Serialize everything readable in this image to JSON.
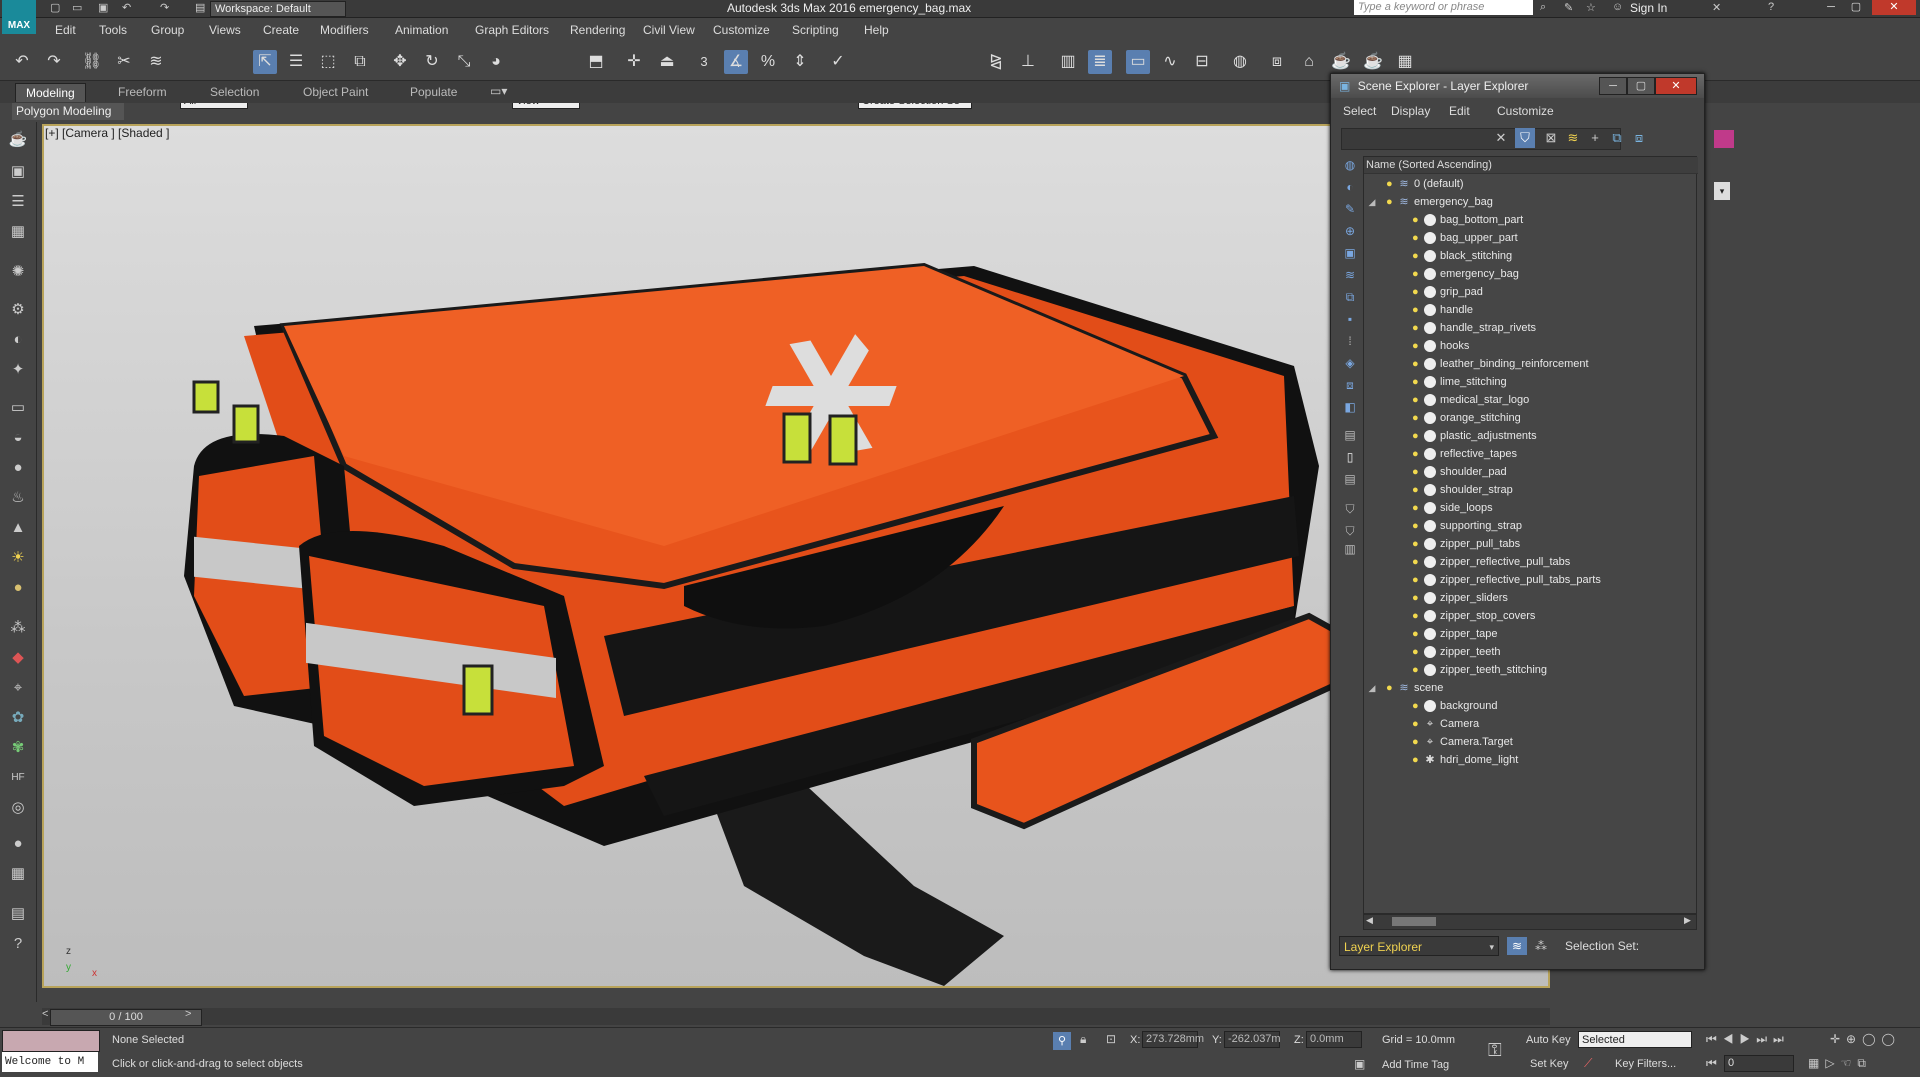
{
  "titlebar": {
    "app_logo_text": "MAX",
    "workspace": "Workspace: Default",
    "title": "Autodesk 3ds Max 2016      emergency_bag.max",
    "search_placeholder": "Type a keyword or phrase",
    "sign_in": "Sign In"
  },
  "menu": [
    "Edit",
    "Tools",
    "Group",
    "Views",
    "Create",
    "Modifiers",
    "Animation",
    "Graph Editors",
    "Rendering",
    "Civil View",
    "Customize",
    "Scripting",
    "Help"
  ],
  "toolbar": {
    "filter_select": "All",
    "reference_select": "View",
    "snap_label": "3",
    "selection_set_placeholder": "Create Selection Se"
  },
  "ribbon": {
    "tabs": [
      "Modeling",
      "Freeform",
      "Selection",
      "Object Paint",
      "Populate"
    ],
    "active_tab": "Modeling",
    "sub_label": "Polygon Modeling"
  },
  "viewport": {
    "label": "[+] [Camera ] [Shaded ]",
    "axis_z": "z",
    "axis_y": "y",
    "axis_x": "x"
  },
  "timeline": {
    "frame": "0 / 100"
  },
  "status": {
    "welcome": "Welcome to M",
    "selection": "None Selected",
    "prompt": "Click or click-and-drag to select objects",
    "x_label": "X:",
    "x_value": "273.728mm",
    "y_label": "Y:",
    "y_value": "-262.037m",
    "z_label": "Z:",
    "z_value": "0.0mm",
    "grid": "Grid = 10.0mm",
    "add_time_tag": "Add Time Tag",
    "auto_key": "Auto Key",
    "selected": "Selected",
    "set_key": "Set Key",
    "key_filters": "Key Filters...",
    "frame_field": "0"
  },
  "scene_explorer": {
    "title": "Scene Explorer - Layer Explorer",
    "menu": [
      "Select",
      "Display",
      "Edit",
      "Customize"
    ],
    "column_header": "Name (Sorted Ascending)",
    "bottom_mode": "Layer Explorer",
    "selection_set_label": "Selection Set:",
    "layers": [
      {
        "name": "0 (default)",
        "expanded": false,
        "children": []
      },
      {
        "name": "emergency_bag",
        "expanded": true,
        "children": [
          "bag_bottom_part",
          "bag_upper_part",
          "black_stitching",
          "emergency_bag",
          "grip_pad",
          "handle",
          "handle_strap_rivets",
          "hooks",
          "leather_binding_reinforcement",
          "lime_stitching",
          "medical_star_logo",
          "orange_stitching",
          "plastic_adjustments",
          "reflective_tapes",
          "shoulder_pad",
          "shoulder_strap",
          "side_loops",
          "supporting_strap",
          "zipper_pull_tabs",
          "zipper_reflective_pull_tabs",
          "zipper_reflective_pull_tabs_parts",
          "zipper_sliders",
          "zipper_stop_covers",
          "zipper_tape",
          "zipper_teeth",
          "zipper_teeth_stitching"
        ]
      },
      {
        "name": "scene",
        "expanded": true,
        "children": [
          "background",
          "Camera",
          "Camera.Target",
          "hdri_dome_light"
        ]
      }
    ]
  },
  "colors": {
    "bag_orange": "#e8541c",
    "viewport_border": "#b8a35a",
    "accent_blue": "#5a7fb0",
    "layer_explorer_text": "#f0d250"
  }
}
